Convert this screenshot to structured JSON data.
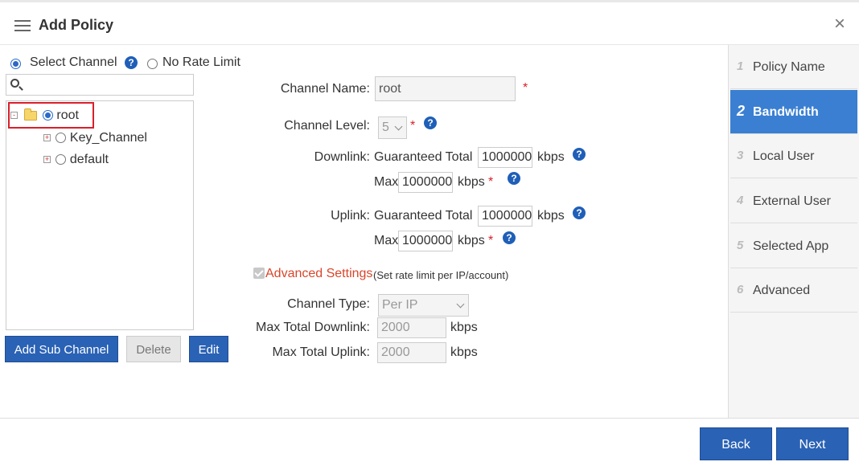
{
  "dialog": {
    "title": "Add Policy",
    "close_symbol": "×"
  },
  "steps": [
    {
      "num": "1",
      "label": "Policy Name",
      "active": false
    },
    {
      "num": "2",
      "label": "Bandwidth",
      "active": true
    },
    {
      "num": "3",
      "label": "Local User",
      "active": false
    },
    {
      "num": "4",
      "label": "External User",
      "active": false
    },
    {
      "num": "5",
      "label": "Selected App",
      "active": false
    },
    {
      "num": "6",
      "label": "Advanced",
      "active": false
    }
  ],
  "mode": {
    "select_channel_label": "Select Channel",
    "no_rate_limit_label": "No Rate Limit",
    "selected": "select_channel"
  },
  "search": {
    "value": ""
  },
  "tree": {
    "root": {
      "label": "root",
      "expander": "-",
      "selected": true
    },
    "children": [
      {
        "label": "Key_Channel",
        "expander": "+",
        "selected": false
      },
      {
        "label": "default",
        "expander": "+",
        "selected": false
      }
    ]
  },
  "tree_buttons": {
    "add_sub_channel": "Add Sub Channel",
    "delete": "Delete",
    "edit": "Edit"
  },
  "form": {
    "channel_name_label": "Channel Name:",
    "channel_name_value": "root",
    "channel_level_label": "Channel Level:",
    "channel_level_value": "5",
    "downlink_label": "Downlink:",
    "guaranteed_total_label": "Guaranteed Total",
    "downlink_guaranteed": "1000000",
    "max_label": "Max",
    "downlink_max": "1000000",
    "uplink_label": "Uplink:",
    "uplink_guaranteed": "1000000",
    "uplink_max": "1000000",
    "unit_kbps": "kbps",
    "required_mark": "*",
    "help_mark": "?",
    "advanced_settings_label": "Advanced Settings",
    "advanced_settings_hint": "(Set rate limit per IP/account)",
    "advanced_checked": true,
    "channel_type_label": "Channel Type:",
    "channel_type_value": "Per IP",
    "max_total_downlink_label": "Max Total Downlink:",
    "max_total_downlink_value": "2000",
    "max_total_uplink_label": "Max Total Uplink:",
    "max_total_uplink_value": "2000"
  },
  "footer": {
    "back": "Back",
    "next": "Next"
  },
  "colors": {
    "accent": "#2a62b5",
    "active_step": "#3a7fd2",
    "required": "#d9202a",
    "advanced_label": "#d9452a"
  }
}
